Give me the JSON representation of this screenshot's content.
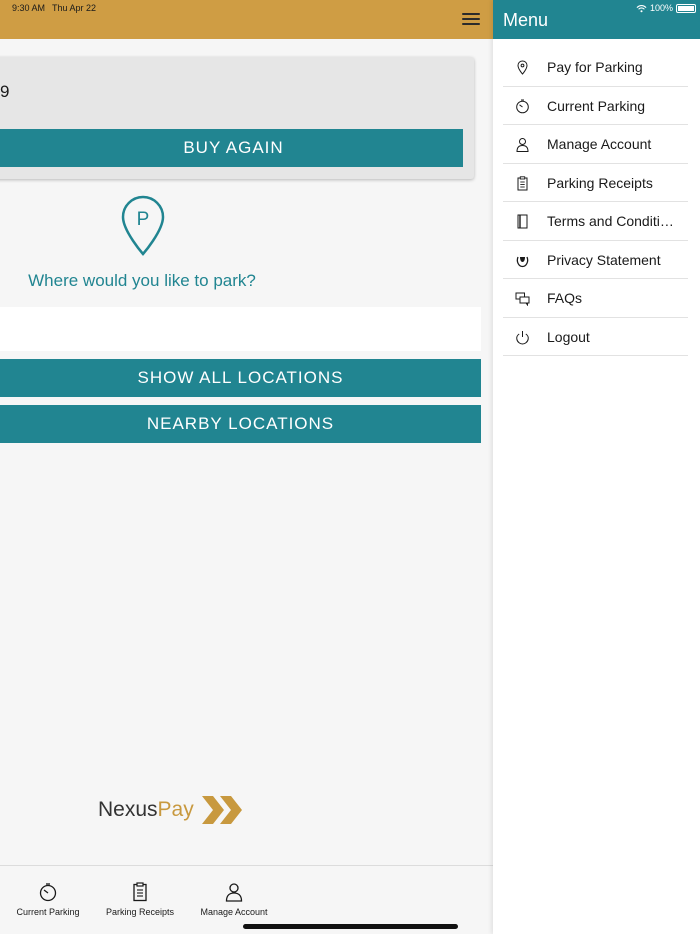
{
  "status_bar": {
    "time": "9:30 AM",
    "date": "Thu Apr 22",
    "battery": "100%"
  },
  "main": {
    "recent_card": {
      "partial_text": "9",
      "buy_again_label": "BUY AGAIN"
    },
    "pin_letter": "P",
    "question": "Where would you like to park?",
    "search": {
      "value": "",
      "placeholder": ""
    },
    "show_all_label": "SHOW ALL LOCATIONS",
    "nearby_label": "NEARBY LOCATIONS",
    "logo": {
      "part1": "Nexus",
      "part2": "Pay"
    }
  },
  "tabs": [
    {
      "label": "Current Parking",
      "icon": "timer-icon"
    },
    {
      "label": "Parking Receipts",
      "icon": "receipt-icon"
    },
    {
      "label": "Manage Account",
      "icon": "person-icon"
    }
  ],
  "menu": {
    "title": "Menu",
    "items": [
      {
        "label": "Pay for Parking",
        "icon": "location-pin-icon"
      },
      {
        "label": "Current Parking",
        "icon": "timer-icon"
      },
      {
        "label": "Manage Account",
        "icon": "person-icon"
      },
      {
        "label": "Parking Receipts",
        "icon": "receipt-icon"
      },
      {
        "label": "Terms and Conditions",
        "icon": "book-icon"
      },
      {
        "label": "Privacy Statement",
        "icon": "privacy-icon"
      },
      {
        "label": "FAQs",
        "icon": "chat-bubbles-icon"
      },
      {
        "label": "Logout",
        "icon": "power-icon"
      }
    ]
  },
  "colors": {
    "teal": "#218591",
    "gold": "#cf9d44",
    "logo_gold": "#c8993f",
    "background": "#f6f6f6"
  }
}
